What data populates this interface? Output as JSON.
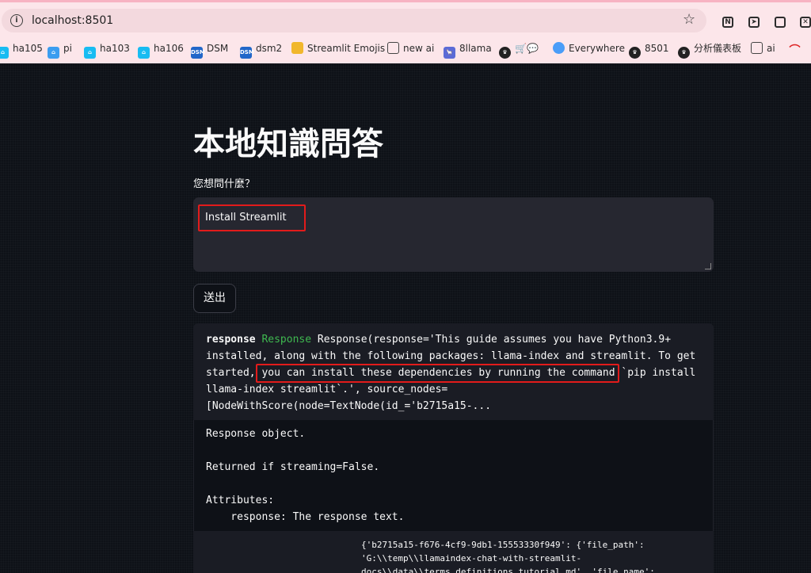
{
  "browser": {
    "url": "localhost:8501",
    "bookmarks": [
      {
        "label": "ha105",
        "icon": "home-assistant-icon"
      },
      {
        "label": "pi",
        "icon": "home-icon"
      },
      {
        "label": "ha103",
        "icon": "home-assistant-icon"
      },
      {
        "label": "ha106",
        "icon": "home-assistant-icon"
      },
      {
        "label": "DSM",
        "icon": "dsm-icon"
      },
      {
        "label": "dsm2",
        "icon": "dsm-icon"
      },
      {
        "label": "Streamlit Emojis",
        "icon": "folder-icon"
      },
      {
        "label": "new ai",
        "icon": "folder-icon"
      },
      {
        "label": "8llama",
        "icon": "llama-icon"
      },
      {
        "label": "🛒💬",
        "icon": "crown-icon"
      },
      {
        "label": "Everywhere",
        "icon": "chat-icon"
      },
      {
        "label": "8501",
        "icon": "crown-icon"
      },
      {
        "label": "分析儀表板",
        "icon": "crown-icon"
      },
      {
        "label": "ai",
        "icon": "folder-icon"
      }
    ]
  },
  "page": {
    "title": "本地知識問答",
    "question_label": "您想問什麼？",
    "question_value": "Install Streamlit",
    "submit_label": "送出",
    "response_key": "response",
    "response_type": "Response",
    "response_lines": [
      "Response(response='This guide assumes you have Python3.9+",
      "installed, along with the following packages: llama-index and streamlit. To get",
      "started, you can install these dependencies by running the command `pip install",
      "llama-index streamlit`.', source_nodes=",
      "[NodeWithScore(node=TextNode(id_='b2715a15-..."
    ],
    "doc_lines": [
      "Response object.",
      "",
      "Returned if streaming=False.",
      "",
      "Attributes:",
      "    response: The response text."
    ],
    "dict_lines": [
      "{'b2715a15-f676-4cf9-9db1-15553330f949': {'file_path':",
      "'G:\\\\temp\\\\llamaindex-chat-with-streamlit-",
      "docs\\\\data\\\\terms_definitions_tutorial.md', 'file_name':"
    ]
  }
}
